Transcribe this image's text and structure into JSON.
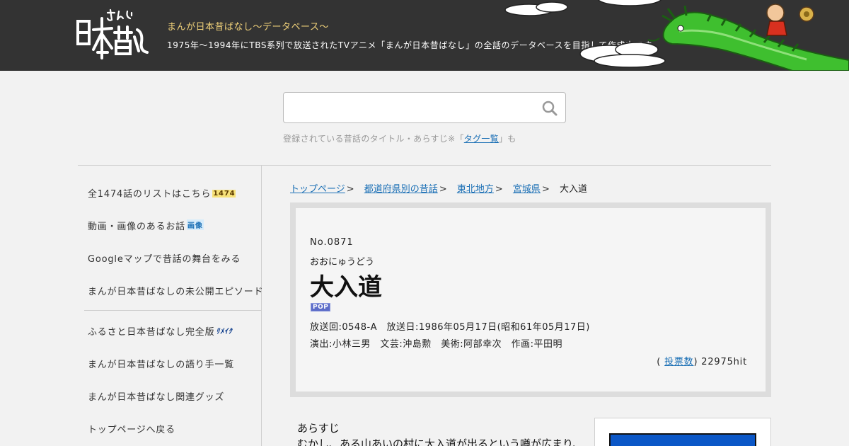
{
  "header": {
    "logo_alt": "まんが日本昔ばなし",
    "tagline": "まんが日本昔ばなし〜データベース〜",
    "subline": "1975年〜1994年にTBS系列で放送されたTVアニメ「まんが日本昔ばなし」の全話のデータベースを目指して作成中です。"
  },
  "search": {
    "placeholder": "",
    "note_before": "登録されている昔話のタイトル・あらすじ※「",
    "note_link": "タグ一覧",
    "note_after": "」も"
  },
  "sidebar": {
    "items": [
      {
        "label": "全1474話のリストはこちら",
        "badge": "1474"
      },
      {
        "label": "動画・画像のあるお話",
        "badge": "画像"
      },
      {
        "label": "Googleマップで昔話の舞台をみる",
        "badge": ""
      },
      {
        "label": "まんが日本昔ばなしの未公開エピソード",
        "badge": ""
      },
      {
        "label": "ふるさと日本昔ばなし完全版",
        "badge": "ﾘﾒｲｸ"
      },
      {
        "label": "まんが日本昔ばなしの語り手一覧",
        "badge": ""
      },
      {
        "label": "まんが日本昔ばなし関連グッズ",
        "badge": ""
      },
      {
        "label": "トップページへ戻る",
        "badge": ""
      }
    ]
  },
  "breadcrumb": {
    "items": [
      "トップページ",
      "都道府県別の昔話",
      "東北地方",
      "宮城県"
    ],
    "current": "大入道"
  },
  "episode": {
    "number": "No.0871",
    "reading": "おおにゅうどう",
    "title": "大入道",
    "badge": "POP",
    "meta1": "放送回:0548-A　放送日:1986年05月17日(昭和61年05月17日)",
    "meta2": "演出:小林三男　文芸:沖島勲　美術:阿部幸次　作画:平田明",
    "hits_link": "投票数",
    "hits_text": ") 22975hit",
    "hits_open": "( "
  },
  "synopsis": {
    "heading": "あらすじ",
    "line1": "むかし、ある山あいの村に大入道が出るという噂が広まり、村人たちは夜になるとおびえて過ごしていました。"
  },
  "colors": {
    "header_bg": "#333333",
    "tagline": "#f1d27a",
    "link": "#1a6fb5",
    "thumb": "#0b57c7"
  },
  "icons": {
    "search": "search-icon",
    "dragon": "dragon-illustration",
    "clouds": "cloud-illustration"
  }
}
